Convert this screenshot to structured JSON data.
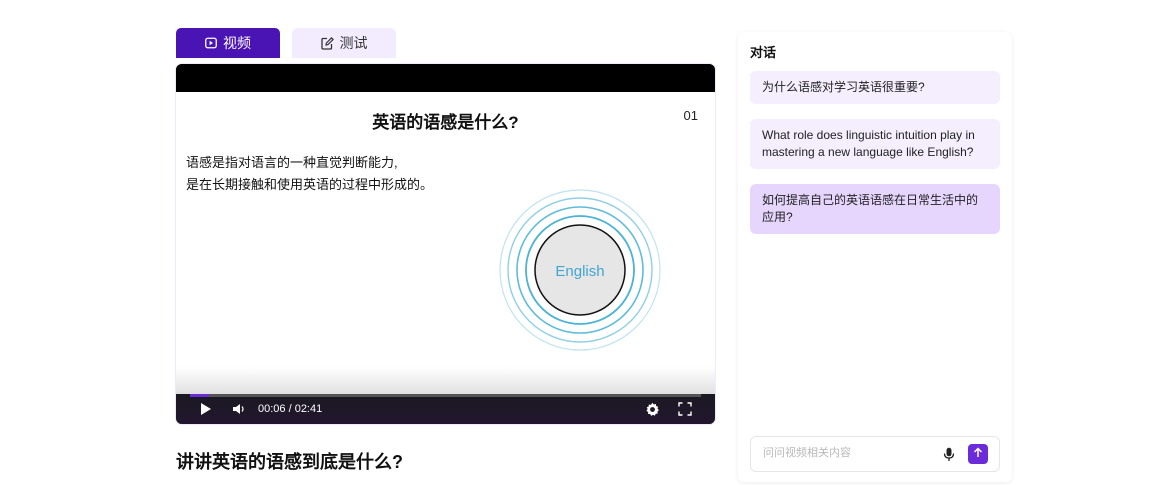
{
  "tabs": [
    {
      "label": "视频",
      "icon": "play-square-icon",
      "active": true
    },
    {
      "label": "测试",
      "icon": "edit-icon",
      "active": false
    }
  ],
  "slide": {
    "title": "英语的语感是什么?",
    "number": "01",
    "lines": [
      "语感是指对语言的一种直觉判断能力,",
      "是在长期接触和使用英语的过程中形成的。"
    ],
    "circle_label": "English"
  },
  "player": {
    "time": "00:06 / 02:41",
    "progress": 0.037
  },
  "video_title": "讲讲英语的语感到底是什么?",
  "chat": {
    "title": "对话",
    "messages": [
      {
        "text": "为什么语感对学习英语很重要?"
      },
      {
        "text": "What role does linguistic intuition play in mastering a new language like English?"
      },
      {
        "text": "如何提高自己的英语语感在日常生活中的应用?"
      }
    ],
    "input_placeholder": "问问视频相关内容"
  },
  "colors": {
    "accent": "#4a13b3",
    "send": "#6b2bd9",
    "bubble_light": "#f5eeff",
    "bubble_dark": "#e6d6fe",
    "circle": "#4bb3d6"
  }
}
